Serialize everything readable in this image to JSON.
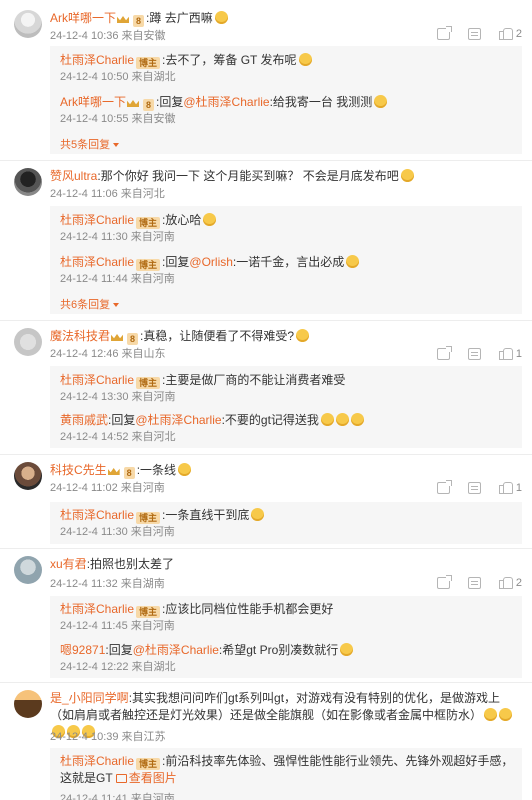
{
  "comments": [
    {
      "user": "Ark咩哪一下",
      "fan_level": "8",
      "text": ":蹲 去广西嘛",
      "time": "24-12-4 10:36 来自安徽",
      "likes": "2",
      "replies": [
        {
          "user": "杜雨泽Charlie",
          "tag": "博主",
          "text": ":去不了，筹备 GT 发布呢",
          "time": "24-12-4 10:50 来自湖北"
        },
        {
          "user": "Ark咩哪一下",
          "tag": "8",
          "prefix": ":回复",
          "at": "@杜雨泽Charlie",
          "text": ":给我寄一台 我测测",
          "time": "24-12-4 10:55 来自安徽"
        }
      ],
      "more": "共5条回复"
    },
    {
      "user": "赞风ultra",
      "text": ":那个你好 我问一下 这个月能买到嘛？ 不会是月底发布吧",
      "time": "24-12-4 11:06 来自河北",
      "likes": "",
      "replies": [
        {
          "user": "杜雨泽Charlie",
          "tag": "博主",
          "text": ":放心哈",
          "time": "24-12-4 11:30 来自河南"
        },
        {
          "user": "杜雨泽Charlie",
          "tag": "博主",
          "prefix": ":回复",
          "at": "@Orlish",
          "text": ":一诺千金，言出必成",
          "time": "24-12-4 11:44 来自河南"
        }
      ],
      "more": "共6条回复"
    },
    {
      "user": "魔法科技君",
      "fan_level": "8",
      "text": ":真稳，让随便看了不得难受?",
      "time": "24-12-4 12:46 来自山东",
      "likes": "1",
      "replies": [
        {
          "user": "杜雨泽Charlie",
          "tag": "博主",
          "text": ":主要是做厂商的不能让消费者难受",
          "time": "24-12-4 13:30 来自河南"
        },
        {
          "user": "黄雨戚武",
          "prefix": ":回复",
          "at": "@杜雨泽Charlie",
          "text": ":不要的gt记得送我",
          "time": "24-12-4 14:52 来自河北"
        }
      ]
    },
    {
      "user": "科技C先生",
      "fan_level": "8",
      "text": ":一条线",
      "time": "24-12-4 11:02 来自河南",
      "likes": "1",
      "replies": [
        {
          "user": "杜雨泽Charlie",
          "tag": "博主",
          "text": ":一条直线干到底",
          "time": "24-12-4 11:30 来自河南"
        }
      ]
    },
    {
      "user": "xu有君",
      "text": ":拍照也别太差了",
      "time": "24-12-4 11:32 来自湖南",
      "likes": "2",
      "replies": [
        {
          "user": "杜雨泽Charlie",
          "tag": "博主",
          "text": ":应该比同档位性能手机都会更好",
          "time": "24-12-4 11:45 来自河南"
        },
        {
          "user": "嗯92871",
          "prefix": ":回复",
          "at": "@杜雨泽Charlie",
          "text": ":希望gt Pro别凑数就行",
          "time": "24-12-4 12:22 来自湖北"
        }
      ]
    },
    {
      "user": "是_小阳同学啊",
      "text": ":其实我想问问咋们gt系列叫gt，对游戏有没有特别的优化，是做游戏上（如肩肩或者触控还是灯光效果）还是做全能旗舰（如在影像或者金属中框防水）",
      "time": "24-12-4 10:39 来自江苏",
      "likes": "",
      "replies": [
        {
          "user": "杜雨泽Charlie",
          "tag": "博主",
          "text": ":前沿科技率先体验、强悍性能性能行业领先、先锋外观超好手感，这就是GT",
          "pic_label": "查看图片",
          "time": "24-12-4 11:41 来自河南"
        }
      ]
    }
  ]
}
